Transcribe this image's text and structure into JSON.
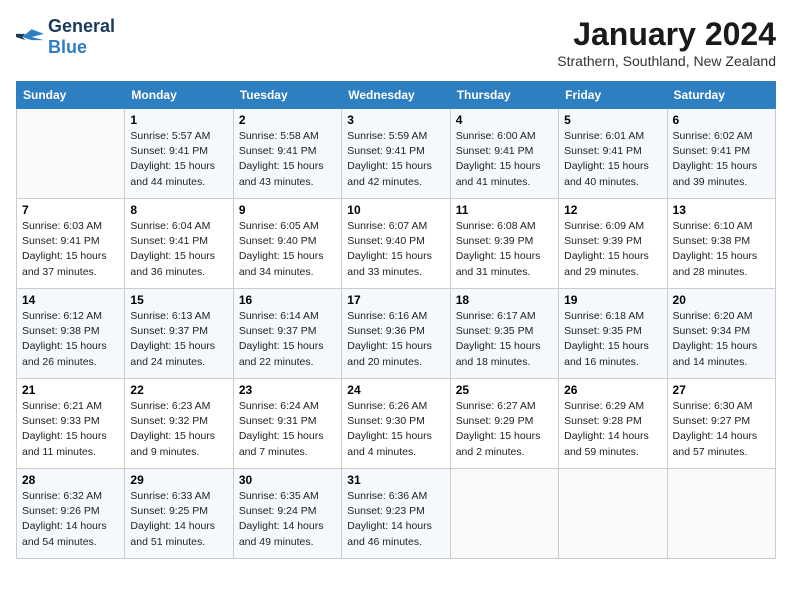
{
  "logo": {
    "line1": "General",
    "line2": "Blue"
  },
  "title": "January 2024",
  "subtitle": "Strathern, Southland, New Zealand",
  "days_of_week": [
    "Sunday",
    "Monday",
    "Tuesday",
    "Wednesday",
    "Thursday",
    "Friday",
    "Saturday"
  ],
  "weeks": [
    [
      {
        "day": "",
        "info": ""
      },
      {
        "day": "1",
        "info": "Sunrise: 5:57 AM\nSunset: 9:41 PM\nDaylight: 15 hours\nand 44 minutes."
      },
      {
        "day": "2",
        "info": "Sunrise: 5:58 AM\nSunset: 9:41 PM\nDaylight: 15 hours\nand 43 minutes."
      },
      {
        "day": "3",
        "info": "Sunrise: 5:59 AM\nSunset: 9:41 PM\nDaylight: 15 hours\nand 42 minutes."
      },
      {
        "day": "4",
        "info": "Sunrise: 6:00 AM\nSunset: 9:41 PM\nDaylight: 15 hours\nand 41 minutes."
      },
      {
        "day": "5",
        "info": "Sunrise: 6:01 AM\nSunset: 9:41 PM\nDaylight: 15 hours\nand 40 minutes."
      },
      {
        "day": "6",
        "info": "Sunrise: 6:02 AM\nSunset: 9:41 PM\nDaylight: 15 hours\nand 39 minutes."
      }
    ],
    [
      {
        "day": "7",
        "info": "Sunrise: 6:03 AM\nSunset: 9:41 PM\nDaylight: 15 hours\nand 37 minutes."
      },
      {
        "day": "8",
        "info": "Sunrise: 6:04 AM\nSunset: 9:41 PM\nDaylight: 15 hours\nand 36 minutes."
      },
      {
        "day": "9",
        "info": "Sunrise: 6:05 AM\nSunset: 9:40 PM\nDaylight: 15 hours\nand 34 minutes."
      },
      {
        "day": "10",
        "info": "Sunrise: 6:07 AM\nSunset: 9:40 PM\nDaylight: 15 hours\nand 33 minutes."
      },
      {
        "day": "11",
        "info": "Sunrise: 6:08 AM\nSunset: 9:39 PM\nDaylight: 15 hours\nand 31 minutes."
      },
      {
        "day": "12",
        "info": "Sunrise: 6:09 AM\nSunset: 9:39 PM\nDaylight: 15 hours\nand 29 minutes."
      },
      {
        "day": "13",
        "info": "Sunrise: 6:10 AM\nSunset: 9:38 PM\nDaylight: 15 hours\nand 28 minutes."
      }
    ],
    [
      {
        "day": "14",
        "info": "Sunrise: 6:12 AM\nSunset: 9:38 PM\nDaylight: 15 hours\nand 26 minutes."
      },
      {
        "day": "15",
        "info": "Sunrise: 6:13 AM\nSunset: 9:37 PM\nDaylight: 15 hours\nand 24 minutes."
      },
      {
        "day": "16",
        "info": "Sunrise: 6:14 AM\nSunset: 9:37 PM\nDaylight: 15 hours\nand 22 minutes."
      },
      {
        "day": "17",
        "info": "Sunrise: 6:16 AM\nSunset: 9:36 PM\nDaylight: 15 hours\nand 20 minutes."
      },
      {
        "day": "18",
        "info": "Sunrise: 6:17 AM\nSunset: 9:35 PM\nDaylight: 15 hours\nand 18 minutes."
      },
      {
        "day": "19",
        "info": "Sunrise: 6:18 AM\nSunset: 9:35 PM\nDaylight: 15 hours\nand 16 minutes."
      },
      {
        "day": "20",
        "info": "Sunrise: 6:20 AM\nSunset: 9:34 PM\nDaylight: 15 hours\nand 14 minutes."
      }
    ],
    [
      {
        "day": "21",
        "info": "Sunrise: 6:21 AM\nSunset: 9:33 PM\nDaylight: 15 hours\nand 11 minutes."
      },
      {
        "day": "22",
        "info": "Sunrise: 6:23 AM\nSunset: 9:32 PM\nDaylight: 15 hours\nand 9 minutes."
      },
      {
        "day": "23",
        "info": "Sunrise: 6:24 AM\nSunset: 9:31 PM\nDaylight: 15 hours\nand 7 minutes."
      },
      {
        "day": "24",
        "info": "Sunrise: 6:26 AM\nSunset: 9:30 PM\nDaylight: 15 hours\nand 4 minutes."
      },
      {
        "day": "25",
        "info": "Sunrise: 6:27 AM\nSunset: 9:29 PM\nDaylight: 15 hours\nand 2 minutes."
      },
      {
        "day": "26",
        "info": "Sunrise: 6:29 AM\nSunset: 9:28 PM\nDaylight: 14 hours\nand 59 minutes."
      },
      {
        "day": "27",
        "info": "Sunrise: 6:30 AM\nSunset: 9:27 PM\nDaylight: 14 hours\nand 57 minutes."
      }
    ],
    [
      {
        "day": "28",
        "info": "Sunrise: 6:32 AM\nSunset: 9:26 PM\nDaylight: 14 hours\nand 54 minutes."
      },
      {
        "day": "29",
        "info": "Sunrise: 6:33 AM\nSunset: 9:25 PM\nDaylight: 14 hours\nand 51 minutes."
      },
      {
        "day": "30",
        "info": "Sunrise: 6:35 AM\nSunset: 9:24 PM\nDaylight: 14 hours\nand 49 minutes."
      },
      {
        "day": "31",
        "info": "Sunrise: 6:36 AM\nSunset: 9:23 PM\nDaylight: 14 hours\nand 46 minutes."
      },
      {
        "day": "",
        "info": ""
      },
      {
        "day": "",
        "info": ""
      },
      {
        "day": "",
        "info": ""
      }
    ]
  ]
}
